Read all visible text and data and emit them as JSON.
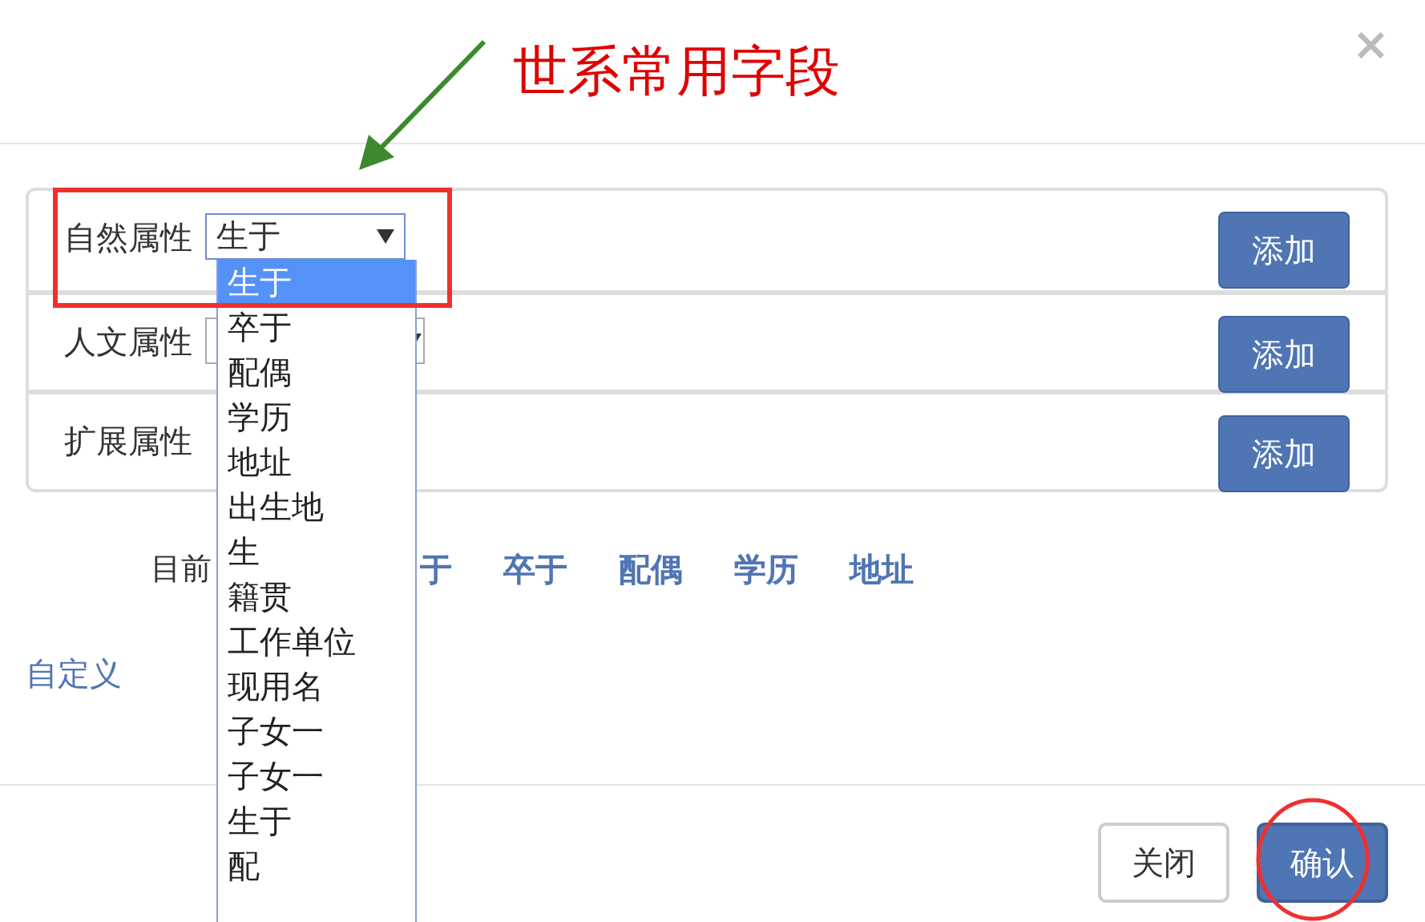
{
  "dialog": {
    "annotation": "世系常用字段",
    "close": "×"
  },
  "attributes": [
    {
      "label": "自然属性",
      "kind": "select",
      "value": "生于",
      "open": true,
      "button": "添加"
    },
    {
      "label": "人文属性",
      "kind": "select",
      "open": false,
      "button": "添加"
    },
    {
      "label": "扩展属性",
      "kind": "plain",
      "button": "添加"
    }
  ],
  "dropdown": {
    "options": [
      {
        "label": "生于",
        "selected": true
      },
      {
        "label": "卒于",
        "selected": false
      },
      {
        "label": "配偶",
        "selected": false
      },
      {
        "label": "学历",
        "selected": false
      },
      {
        "label": "地址",
        "selected": false
      },
      {
        "label": "出生地",
        "selected": false
      },
      {
        "label": "生",
        "selected": false
      },
      {
        "label": "籍贯",
        "selected": false
      },
      {
        "label": "工作单位",
        "selected": false
      },
      {
        "label": "现用名",
        "selected": false
      },
      {
        "label": "子女一",
        "selected": false
      },
      {
        "label": "子女一",
        "selected": false
      },
      {
        "label": "生于",
        "selected": false
      },
      {
        "label": "配",
        "selected": false
      }
    ]
  },
  "current": {
    "label": "目前",
    "tags": [
      "于",
      "卒于",
      "配偶",
      "学历",
      "地址"
    ]
  },
  "custom_link": "自定义",
  "buttons": [
    {
      "label": "关闭",
      "kind": "default"
    },
    {
      "label": "确认",
      "kind": "primary"
    }
  ]
}
